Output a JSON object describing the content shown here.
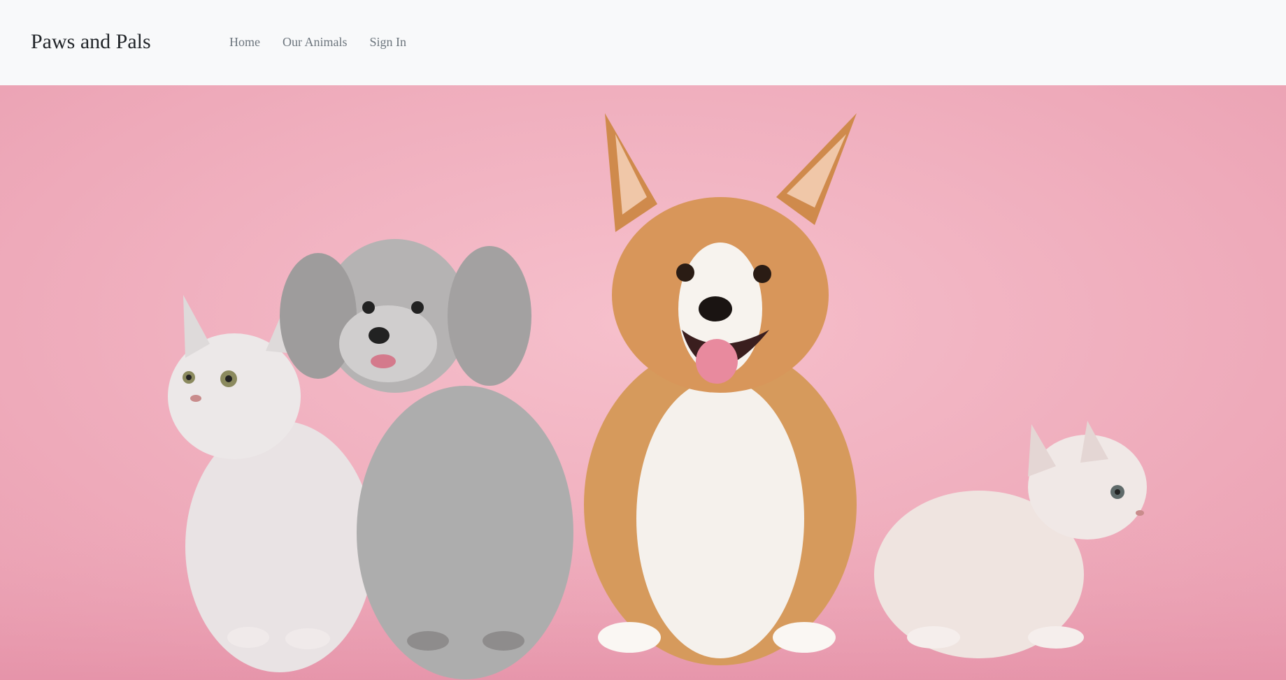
{
  "navbar": {
    "brand": "Paws and Pals",
    "links": [
      {
        "label": "Home"
      },
      {
        "label": "Our Animals"
      },
      {
        "label": "Sign In"
      }
    ]
  },
  "hero": {
    "image": "hero-pets-photo",
    "subjects": [
      "cat",
      "poodle",
      "corgi",
      "cat"
    ]
  },
  "colors": {
    "navbar_bg": "#f8f9fa",
    "hero_bg": "#f2b6c2",
    "brand_text": "#212529",
    "nav_link": "#6c757d"
  }
}
